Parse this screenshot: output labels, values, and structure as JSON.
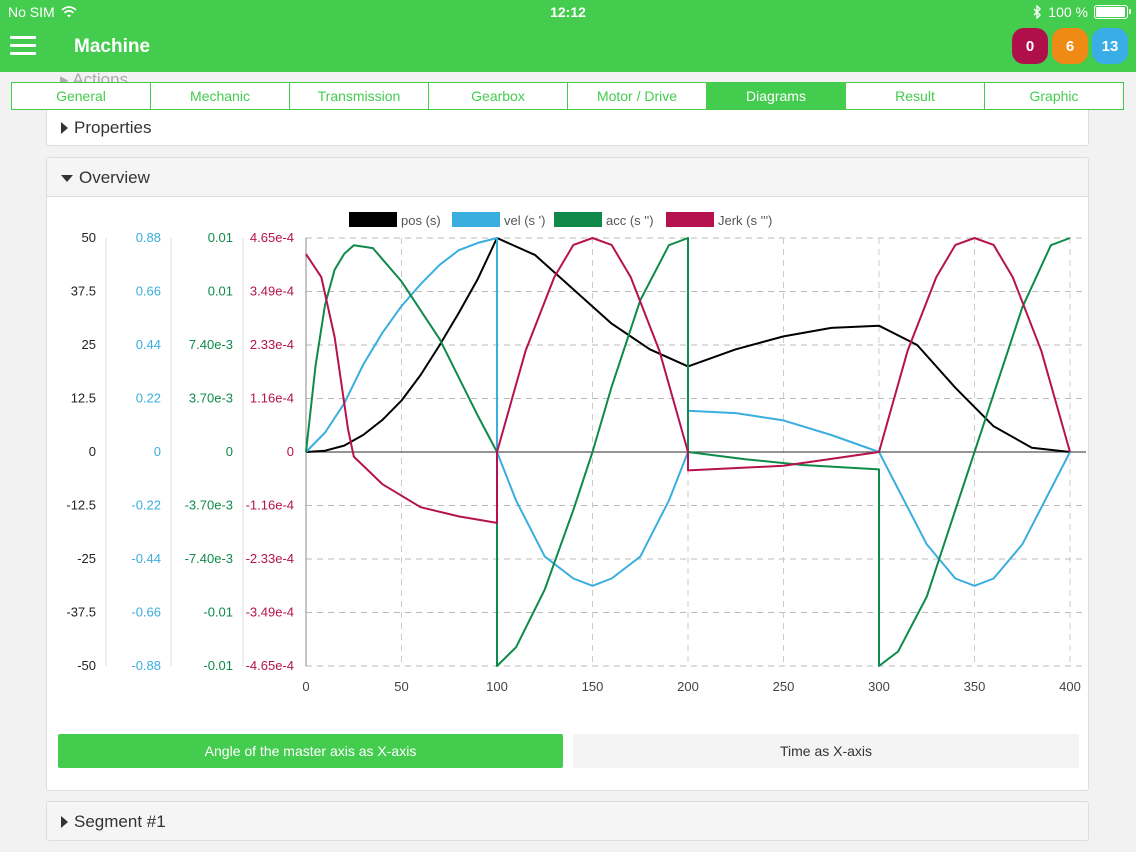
{
  "status": {
    "carrier": "No SIM",
    "time": "12:12",
    "battery": "100 %",
    "battery_level": 1.0
  },
  "header": {
    "title": "Machine",
    "badges": [
      {
        "value": "0",
        "color": "#b0104a"
      },
      {
        "value": "6",
        "color": "#ef8a14"
      },
      {
        "value": "13",
        "color": "#39aee6"
      }
    ]
  },
  "ghost_section": "Actions",
  "tabs": [
    {
      "label": "General"
    },
    {
      "label": "Mechanic"
    },
    {
      "label": "Transmission"
    },
    {
      "label": "Gearbox"
    },
    {
      "label": "Motor / Drive"
    },
    {
      "label": "Diagrams",
      "active": true
    },
    {
      "label": "Result"
    },
    {
      "label": "Graphic"
    }
  ],
  "properties": {
    "title": "Properties"
  },
  "overview": {
    "title": "Overview",
    "x_axis_buttons": {
      "angle": "Angle of the master axis as X-axis",
      "time": "Time as X-axis",
      "selected": "angle"
    }
  },
  "segment": {
    "title": "Segment #1"
  },
  "chart_data": {
    "type": "line",
    "xlim": [
      0,
      400
    ],
    "x_ticks": [
      "0",
      "50",
      "100",
      "150",
      "200",
      "250",
      "300",
      "350",
      "400"
    ],
    "grid": true,
    "legend_position": "top",
    "y_axes": [
      {
        "color": "#222222",
        "ylim": [
          -50,
          50
        ],
        "ticks": [
          "50",
          "37.5",
          "25",
          "12.5",
          "0",
          "-12.5",
          "-25",
          "-37.5",
          "-50"
        ]
      },
      {
        "color": "#3aaede",
        "ylim": [
          -0.88,
          0.88
        ],
        "ticks": [
          "0.88",
          "0.66",
          "0.44",
          "0.22",
          "0",
          "-0.22",
          "-0.44",
          "-0.66",
          "-0.88"
        ]
      },
      {
        "color": "#0f8a4a",
        "ylim": [
          -0.0148,
          0.0148
        ],
        "ticks": [
          "0.01",
          "0.01",
          "7.40e-3",
          "3.70e-3",
          "0",
          "-3.70e-3",
          "-7.40e-3",
          "-0.01",
          "-0.01"
        ]
      },
      {
        "color": "#b5124f",
        "ylim": [
          -0.000465,
          0.000465
        ],
        "ticks": [
          "4.65e-4",
          "3.49e-4",
          "2.33e-4",
          "1.16e-4",
          "0",
          "-1.16e-4",
          "-2.33e-4",
          "-3.49e-4",
          "-4.65e-4"
        ]
      }
    ],
    "series": [
      {
        "name": "pos (s)",
        "color": "#000000",
        "points": [
          [
            0,
            0
          ],
          [
            10,
            0.3
          ],
          [
            20,
            1.5
          ],
          [
            30,
            4
          ],
          [
            40,
            7.5
          ],
          [
            50,
            12
          ],
          [
            60,
            18
          ],
          [
            70,
            25
          ],
          [
            80,
            32.5
          ],
          [
            90,
            40.5
          ],
          [
            100,
            50
          ],
          [
            120,
            46
          ],
          [
            140,
            38
          ],
          [
            160,
            30
          ],
          [
            180,
            24
          ],
          [
            200,
            20
          ],
          [
            225,
            24
          ],
          [
            250,
            27
          ],
          [
            275,
            29
          ],
          [
            300,
            29.5
          ],
          [
            320,
            25
          ],
          [
            340,
            15
          ],
          [
            360,
            6
          ],
          [
            380,
            1
          ],
          [
            400,
            0
          ]
        ]
      },
      {
        "name": "vel (s ')",
        "color": "#3aaede",
        "points": [
          [
            0,
            0
          ],
          [
            10,
            0.08
          ],
          [
            20,
            0.2
          ],
          [
            30,
            0.36
          ],
          [
            40,
            0.49
          ],
          [
            50,
            0.6
          ],
          [
            60,
            0.69
          ],
          [
            70,
            0.77
          ],
          [
            80,
            0.83
          ],
          [
            90,
            0.86
          ],
          [
            100,
            0.88
          ],
          [
            100,
            0
          ],
          [
            110,
            -0.2
          ],
          [
            125,
            -0.43
          ],
          [
            140,
            -0.52
          ],
          [
            150,
            -0.55
          ],
          [
            160,
            -0.52
          ],
          [
            175,
            -0.43
          ],
          [
            190,
            -0.2
          ],
          [
            200,
            0
          ],
          [
            200,
            0.17
          ],
          [
            225,
            0.16
          ],
          [
            250,
            0.13
          ],
          [
            275,
            0.07
          ],
          [
            300,
            0
          ],
          [
            325,
            -0.38
          ],
          [
            340,
            -0.52
          ],
          [
            350,
            -0.55
          ],
          [
            360,
            -0.52
          ],
          [
            375,
            -0.38
          ],
          [
            400,
            0
          ]
        ]
      },
      {
        "name": "acc (s '')",
        "color": "#0f8a4a",
        "points": [
          [
            0,
            0
          ],
          [
            5,
            0.006
          ],
          [
            10,
            0.0102
          ],
          [
            15,
            0.0126
          ],
          [
            20,
            0.0137
          ],
          [
            25,
            0.0143
          ],
          [
            35,
            0.0141
          ],
          [
            50,
            0.0118
          ],
          [
            70,
            0.0078
          ],
          [
            90,
            0.0025
          ],
          [
            100,
            0
          ],
          [
            100,
            -0.0148
          ],
          [
            110,
            -0.0135
          ],
          [
            125,
            -0.0095
          ],
          [
            140,
            -0.004
          ],
          [
            150,
            0
          ],
          [
            160,
            0.0045
          ],
          [
            175,
            0.0105
          ],
          [
            190,
            0.0143
          ],
          [
            200,
            0.0148
          ],
          [
            200,
            0
          ],
          [
            230,
            -0.0005
          ],
          [
            260,
            -0.0009
          ],
          [
            300,
            -0.0012
          ],
          [
            300,
            -0.0148
          ],
          [
            310,
            -0.0138
          ],
          [
            325,
            -0.01
          ],
          [
            340,
            -0.004
          ],
          [
            350,
            0
          ],
          [
            360,
            0.004
          ],
          [
            375,
            0.01
          ],
          [
            390,
            0.0143
          ],
          [
            400,
            0.0148
          ]
        ]
      },
      {
        "name": "Jerk (s ''')",
        "color": "#b5124f",
        "points": [
          [
            0,
            0.00043
          ],
          [
            8,
            0.00038
          ],
          [
            15,
            0.00025
          ],
          [
            22,
            5e-05
          ],
          [
            25,
            -1e-05
          ],
          [
            40,
            -7e-05
          ],
          [
            60,
            -0.00012
          ],
          [
            80,
            -0.00014
          ],
          [
            100,
            -0.000154
          ],
          [
            100,
            0
          ],
          [
            115,
            0.00022
          ],
          [
            130,
            0.00038
          ],
          [
            140,
            0.00045
          ],
          [
            150,
            0.000465
          ],
          [
            160,
            0.00045
          ],
          [
            170,
            0.00038
          ],
          [
            185,
            0.00022
          ],
          [
            200,
            0
          ],
          [
            200,
            -4e-05
          ],
          [
            250,
            -3e-05
          ],
          [
            300,
            0
          ],
          [
            315,
            0.00022
          ],
          [
            330,
            0.00038
          ],
          [
            340,
            0.00045
          ],
          [
            350,
            0.000465
          ],
          [
            360,
            0.00045
          ],
          [
            370,
            0.00038
          ],
          [
            385,
            0.00022
          ],
          [
            400,
            0
          ]
        ]
      }
    ]
  }
}
